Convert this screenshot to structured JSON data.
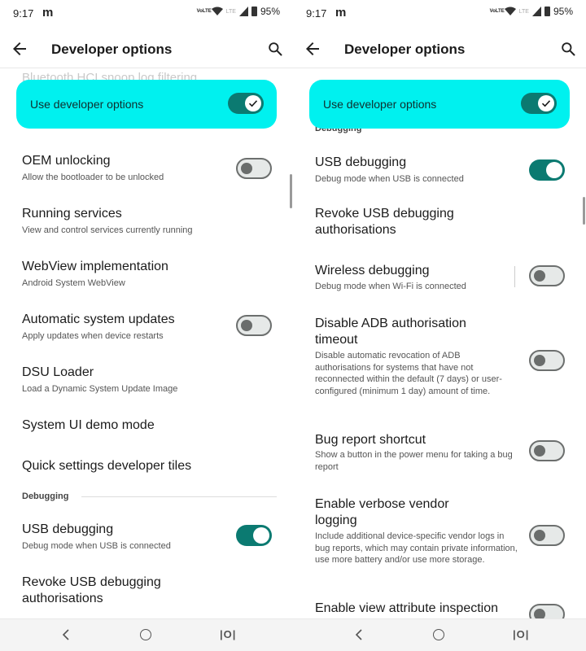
{
  "left": {
    "status": {
      "time": "9:17",
      "notif": "m",
      "volte": "VoLTE",
      "lte": "LTE",
      "battery": "95%"
    },
    "title": "Developer options",
    "ghost_above": "Bluetooth HCI snoop log filtering",
    "master": {
      "label": "Use developer options",
      "on": true
    },
    "items": [
      {
        "title": "OEM unlocking",
        "summary": "Allow the bootloader to be unlocked",
        "toggle": "off"
      },
      {
        "title": "Running services",
        "summary": "View and control services currently running"
      },
      {
        "title": "WebView implementation",
        "summary": "Android System WebView"
      },
      {
        "title": "Automatic system updates",
        "summary": "Apply updates when device restarts",
        "toggle": "off"
      },
      {
        "title": "DSU Loader",
        "summary": "Load a Dynamic System Update Image"
      },
      {
        "title": "System UI demo mode"
      },
      {
        "title": "Quick settings developer tiles"
      }
    ],
    "section": "Debugging",
    "debug_items": [
      {
        "title": "USB debugging",
        "summary": "Debug mode when USB is connected",
        "toggle": "on"
      },
      {
        "title": "Revoke USB debugging authorisations"
      }
    ]
  },
  "right": {
    "status": {
      "time": "9:17",
      "notif": "m",
      "volte": "VoLTE",
      "lte": "LTE",
      "battery": "95%"
    },
    "title": "Developer options",
    "master": {
      "label": "Use developer options",
      "on": true
    },
    "section_ghost": "Debugging",
    "items": [
      {
        "title": "USB debugging",
        "summary": "Debug mode when USB is connected",
        "toggle": "on"
      },
      {
        "title": "Revoke USB debugging authorisations"
      },
      {
        "title": "Wireless debugging",
        "summary": "Debug mode when Wi-Fi is connected",
        "toggle": "off"
      },
      {
        "title": "Disable ADB authorisation timeout",
        "summary": "Disable automatic revocation of ADB authorisations for systems that have not reconnected within the default (7 days) or user-configured (minimum 1 day) amount of time.",
        "toggle": "off"
      },
      {
        "title": "Bug report shortcut",
        "summary": "Show a button in the power menu for taking a bug report",
        "toggle": "off"
      },
      {
        "title": "Enable verbose vendor logging",
        "summary": "Include additional device-specific vendor logs in bug reports, which may contain private information, use more battery and/or use more storage.",
        "toggle": "off"
      },
      {
        "title": "Enable view attribute inspection",
        "toggle": "off"
      }
    ]
  },
  "colors": {
    "accent": "#00f1ef",
    "toggle_on": "#0b7a71"
  },
  "icons": {
    "back": "arrow-left-icon",
    "search": "search-icon",
    "check": "check-icon",
    "nav_back": "chevron-left-icon",
    "nav_home": "circle-home-icon",
    "nav_recents": "recents-icon"
  }
}
